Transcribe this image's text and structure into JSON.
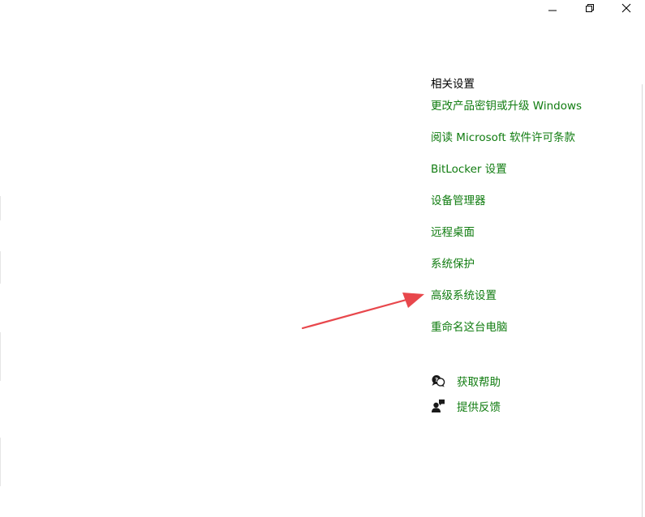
{
  "window_controls": {
    "minimize_icon": "minimize-icon",
    "maximize_icon": "restore-icon",
    "close_icon": "close-icon"
  },
  "related_settings": {
    "title": "相关设置",
    "links": [
      {
        "label": "更改产品密钥或升级 Windows"
      },
      {
        "label": "阅读 Microsoft 软件许可条款"
      },
      {
        "label": "BitLocker 设置"
      },
      {
        "label": "设备管理器"
      },
      {
        "label": "远程桌面"
      },
      {
        "label": "系统保护"
      },
      {
        "label": "高级系统设置"
      },
      {
        "label": "重命名这台电脑"
      }
    ]
  },
  "support": {
    "get_help": {
      "label": "获取帮助",
      "icon": "chat-help-icon"
    },
    "feedback": {
      "label": "提供反馈",
      "icon": "feedback-person-icon"
    }
  },
  "colors": {
    "link": "#107c10",
    "annotation_arrow": "#e8474c"
  }
}
